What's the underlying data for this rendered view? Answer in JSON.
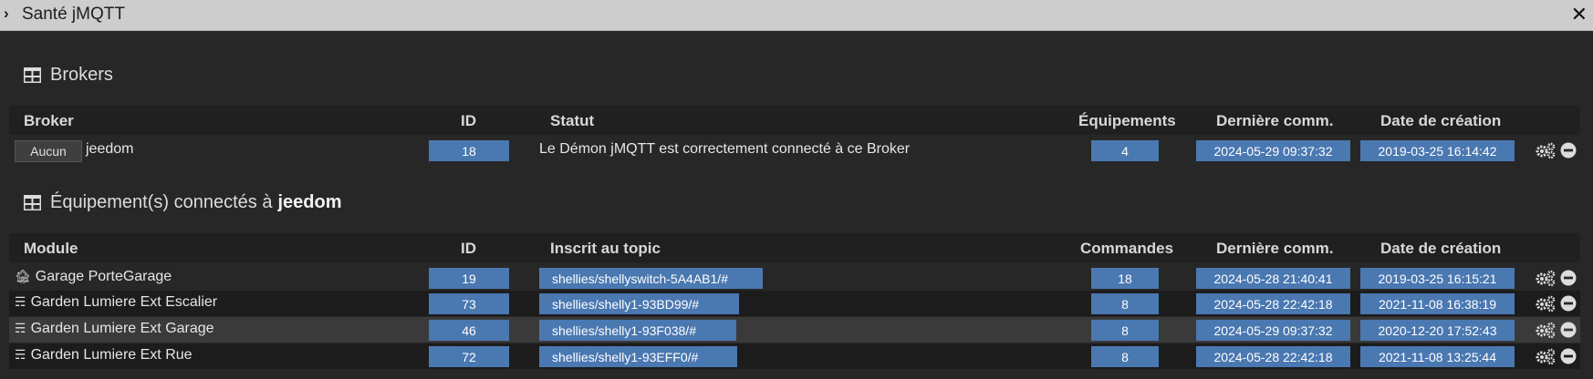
{
  "window": {
    "title": "Santé jMQTT"
  },
  "brokers_section": {
    "title": "Brokers",
    "headers": {
      "broker": "Broker",
      "id": "ID",
      "statut": "Statut",
      "equipements": "Équipements",
      "derniere_comm": "Dernière comm.",
      "date_creation": "Date de création"
    },
    "rows": [
      {
        "button": "Aucun",
        "name": "jeedom",
        "id": "18",
        "statut": "Le Démon jMQTT est correctement connecté à ce Broker",
        "equipements": "4",
        "derniere_comm": "2024-05-29 09:37:32",
        "date_creation": "2019-03-25 16:14:42"
      }
    ]
  },
  "equipements_section": {
    "title_prefix": "Équipement(s) connectés à",
    "title_broker": "jeedom",
    "headers": {
      "module": "Module",
      "id": "ID",
      "topic": "Inscrit au topic",
      "commandes": "Commandes",
      "derniere_comm": "Dernière comm.",
      "date_creation": "Date de création"
    },
    "rows": [
      {
        "icon": "garage-icon",
        "name": "Garage PorteGarage",
        "id": "19",
        "topic": "shellies/shellyswitch-5A4AB1/#",
        "commandes": "18",
        "derniere_comm": "2024-05-28 21:40:41",
        "date_creation": "2019-03-25 16:15:21"
      },
      {
        "icon": "light-icon",
        "name": "Garden Lumiere Ext Escalier",
        "id": "73",
        "topic": "shellies/shelly1-93BD99/#",
        "commandes": "8",
        "derniere_comm": "2024-05-28 22:42:18",
        "date_creation": "2021-11-08 16:38:19"
      },
      {
        "icon": "light-icon",
        "name": "Garden Lumiere Ext Garage",
        "id": "46",
        "topic": "shellies/shelly1-93F038/#",
        "commandes": "8",
        "derniere_comm": "2024-05-29 09:37:32",
        "date_creation": "2020-12-20 17:52:43"
      },
      {
        "icon": "light-icon",
        "name": "Garden Lumiere Ext Rue",
        "id": "72",
        "topic": "shellies/shelly1-93EFF0/#",
        "commandes": "8",
        "derniere_comm": "2024-05-28 22:42:18",
        "date_creation": "2021-11-08 13:25:44"
      }
    ]
  },
  "colors": {
    "label_blue": "#4a78b1",
    "background": "#272727",
    "titlebar": "#cdcdcd"
  }
}
